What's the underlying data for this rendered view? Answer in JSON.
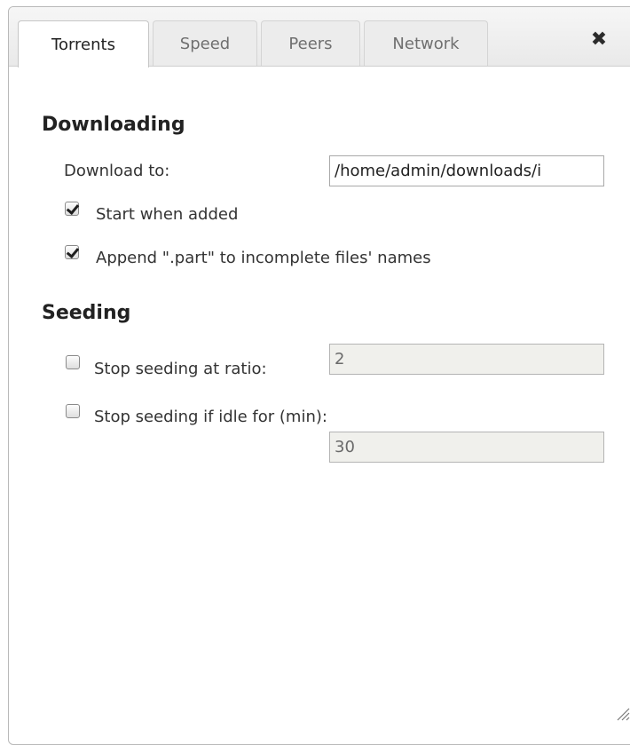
{
  "tabs": [
    {
      "label": "Torrents",
      "active": true
    },
    {
      "label": "Speed",
      "active": false
    },
    {
      "label": "Peers",
      "active": false
    },
    {
      "label": "Network",
      "active": false
    }
  ],
  "close_icon": "close-icon",
  "downloading": {
    "heading": "Downloading",
    "download_to_label": "Download to:",
    "download_to_value": "/home/admin/downloads/i",
    "start_when_added_label": "Start when added",
    "start_when_added_checked": true,
    "append_part_label": "Append \".part\" to incomplete files' names",
    "append_part_checked": true
  },
  "seeding": {
    "heading": "Seeding",
    "stop_at_ratio_label": "Stop seeding at ratio:",
    "stop_at_ratio_checked": false,
    "ratio_value": "2",
    "stop_if_idle_label": "Stop seeding if idle for (min):",
    "stop_if_idle_checked": false,
    "idle_value": "30"
  },
  "colors": {
    "tab_active_bg": "#ffffff",
    "tab_inactive_bg": "#ececec",
    "disabled_input_bg": "#f0f0ec"
  }
}
